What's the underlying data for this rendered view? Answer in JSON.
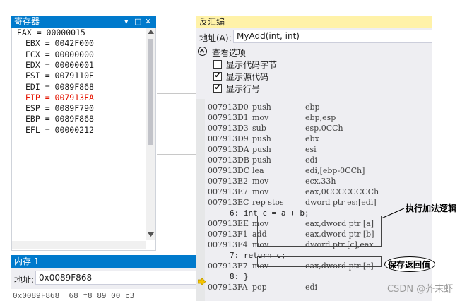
{
  "registers": {
    "title": "寄存器",
    "lines": [
      {
        "text": "EAX = 00000015",
        "changed": false
      },
      {
        "text": "EBX = 0042F000",
        "changed": false
      },
      {
        "text": "ECX = 00000000",
        "changed": false
      },
      {
        "text": "EDX = 00000001",
        "changed": false
      },
      {
        "text": "ESI = 0079110E",
        "changed": false
      },
      {
        "text": "EDI = 0089F868",
        "changed": false
      },
      {
        "text": "EIP = 007913FA",
        "changed": true
      },
      {
        "text": "ESP = 0089F790",
        "changed": false
      },
      {
        "text": "EBP = 0089F868",
        "changed": false
      },
      {
        "text": "EFL = 00000212",
        "changed": false
      }
    ],
    "changed_color": "#e51400"
  },
  "memory": {
    "title": "内存 1",
    "address_label": "地址:",
    "address_value": "0x0089F868",
    "first_row": "0x0089F868  68 f8 89 00 c3"
  },
  "disassembly": {
    "title": "反汇编",
    "address_label": "地址(A):",
    "address_value": "MyAdd(int, int)",
    "options_title": "查看选项",
    "options": [
      {
        "label": "显示代码字节",
        "checked": false
      },
      {
        "label": "显示源代码",
        "checked": true
      },
      {
        "label": "显示行号",
        "checked": true
      }
    ],
    "lines": [
      {
        "kind": "asm",
        "addr": "007913D0",
        "op": "push",
        "args": "ebp"
      },
      {
        "kind": "asm",
        "addr": "007913D1",
        "op": "mov",
        "args": "ebp,esp"
      },
      {
        "kind": "asm",
        "addr": "007913D3",
        "op": "sub",
        "args": "esp,0CCh"
      },
      {
        "kind": "asm",
        "addr": "007913D9",
        "op": "push",
        "args": "ebx"
      },
      {
        "kind": "asm",
        "addr": "007913DA",
        "op": "push",
        "args": "esi"
      },
      {
        "kind": "asm",
        "addr": "007913DB",
        "op": "push",
        "args": "edi"
      },
      {
        "kind": "asm",
        "addr": "007913DC",
        "op": "lea",
        "args": "edi,[ebp-0CCh]"
      },
      {
        "kind": "asm",
        "addr": "007913E2",
        "op": "mov",
        "args": "ecx,33h"
      },
      {
        "kind": "asm",
        "addr": "007913E7",
        "op": "mov",
        "args": "eax,0CCCCCCCCh"
      },
      {
        "kind": "asm",
        "addr": "007913EC",
        "op": "rep stos",
        "args": "dword ptr es:[edi]"
      },
      {
        "kind": "src",
        "text": "6: int c = a + b;"
      },
      {
        "kind": "asm",
        "addr": "007913EE",
        "op": "mov",
        "args": "eax,dword ptr [a]"
      },
      {
        "kind": "asm",
        "addr": "007913F1",
        "op": "add",
        "args": "eax,dword ptr [b]"
      },
      {
        "kind": "asm",
        "addr": "007913F4",
        "op": "mov",
        "args": "dword ptr [c],eax"
      },
      {
        "kind": "src",
        "text": "7: return c;"
      },
      {
        "kind": "asm",
        "addr": "007913F7",
        "op": "mov",
        "args": "eax,dword ptr [c]"
      },
      {
        "kind": "src",
        "text": "8: }"
      },
      {
        "kind": "asm",
        "addr": "007913FA",
        "op": "pop",
        "args": "edi"
      }
    ]
  },
  "annotations": {
    "add_logic": "执行加法逻辑",
    "save_return": "保存返回值"
  },
  "watermark": "CSDN @芥末虾",
  "icons": {
    "panel_dropdown": "chevron-down-icon",
    "panel_maximize": "maximize-icon",
    "panel_close": "close-icon",
    "options_toggle": "chevron-up-circle-icon",
    "instruction_pointer": "arrow-right-icon"
  }
}
